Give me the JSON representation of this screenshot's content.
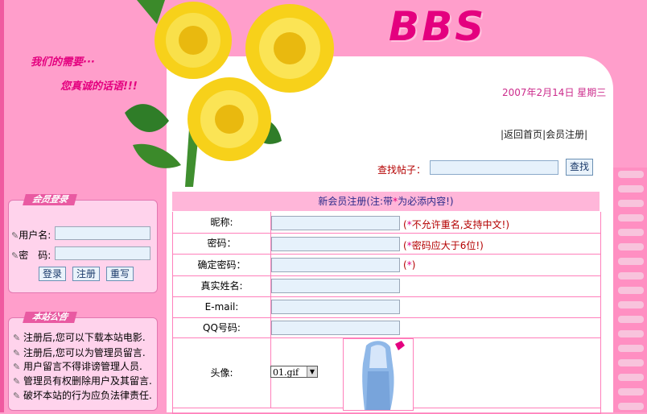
{
  "header": {
    "slogan_line1": "我们的需要···",
    "slogan_line2": "您真诚的话语!!!",
    "logo": "BBS",
    "date": "2007年2月14日 星期三",
    "nav_home": "返回首页",
    "nav_register": "会员注册",
    "search_label": "查找帖子：",
    "search_button": "查找",
    "search_value": ""
  },
  "login": {
    "title": "会员登录",
    "username_label": "用户名:",
    "password_label": "密　码:",
    "username_value": "",
    "password_value": "",
    "login_button": "登录",
    "register_button": "注册",
    "reset_button": "重写"
  },
  "notice": {
    "title": "本站公告",
    "items": [
      "注册后,您可以下载本站电影.",
      "注册后,您可以为管理员留言.",
      "用户留言不得诽谤管理人员.",
      "管理员有权删除用户及其留言.",
      "破坏本站的行为应负法律责任."
    ]
  },
  "form": {
    "header_prefix": "新会员注册(注:带",
    "header_star": "*",
    "header_suffix": "为必添内容!)",
    "rows": [
      {
        "label": "昵称:",
        "value": "",
        "hint_open": "(",
        "hint_star": "*",
        "hint_text": "不允许重名,支持中文!)"
      },
      {
        "label": "密码：",
        "value": "",
        "hint_open": "(",
        "hint_star": "*",
        "hint_text": "密码应大于6位!)"
      },
      {
        "label": "确定密码：",
        "value": "",
        "hint_open": "(",
        "hint_star": "*",
        "hint_text": ")"
      },
      {
        "label": "真实姓名:",
        "value": ""
      },
      {
        "label": "E-mail:",
        "value": ""
      },
      {
        "label": "QQ号码:",
        "value": ""
      }
    ],
    "avatar_label": "头像:",
    "avatar_selected": "01.gif"
  },
  "colors": {
    "background": "#ff9ecb",
    "accent": "#e4007f",
    "hint": "#b40000"
  }
}
